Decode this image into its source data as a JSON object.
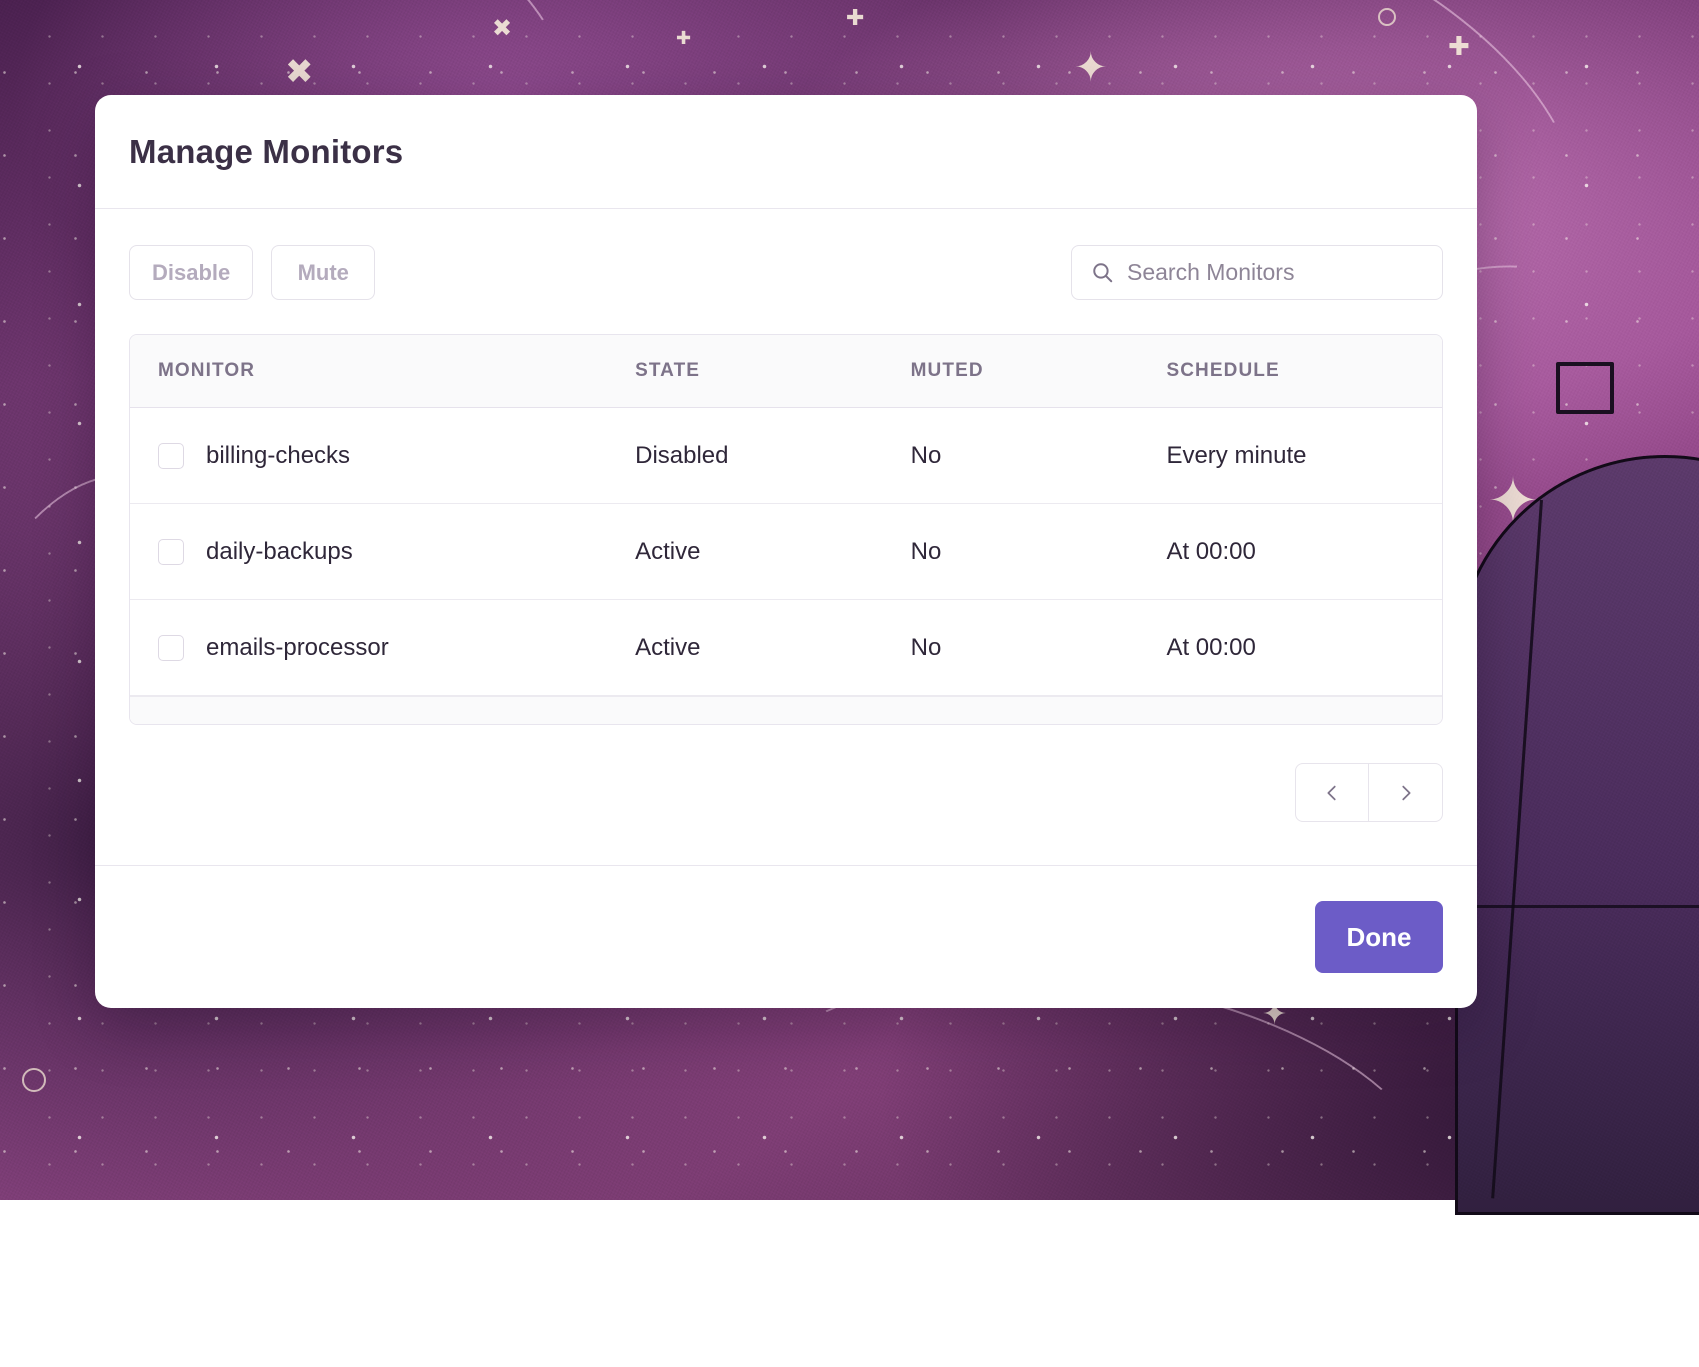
{
  "background": {
    "kind": "cosmic-nebula-illustration",
    "colors": {
      "deep_purple": "#4b2150",
      "mid_purple": "#7a3d78",
      "magenta": "#9c4f93",
      "pink_highlight": "#c074b4",
      "sparkle_cream": "#f7ecdc",
      "dome_dark": "#31203f"
    }
  },
  "modal": {
    "title": "Manage Monitors",
    "toolbar": {
      "disable_label": "Disable",
      "mute_label": "Mute",
      "search": {
        "icon": "search-icon",
        "placeholder": "Search Monitors",
        "value": ""
      }
    },
    "table": {
      "columns": [
        "MONITOR",
        "STATE",
        "MUTED",
        "SCHEDULE"
      ],
      "rows": [
        {
          "checked": false,
          "monitor": "billing-checks",
          "state": "Disabled",
          "muted": "No",
          "schedule": "Every minute"
        },
        {
          "checked": false,
          "monitor": "daily-backups",
          "state": "Active",
          "muted": "No",
          "schedule": "At 00:00"
        },
        {
          "checked": false,
          "monitor": "emails-processor",
          "state": "Active",
          "muted": "No",
          "schedule": "At 00:00"
        }
      ]
    },
    "pagination": {
      "prev_icon": "chevron-left-icon",
      "next_icon": "chevron-right-icon"
    },
    "footer": {
      "done_label": "Done",
      "done_color": "#6c5cc7"
    }
  }
}
